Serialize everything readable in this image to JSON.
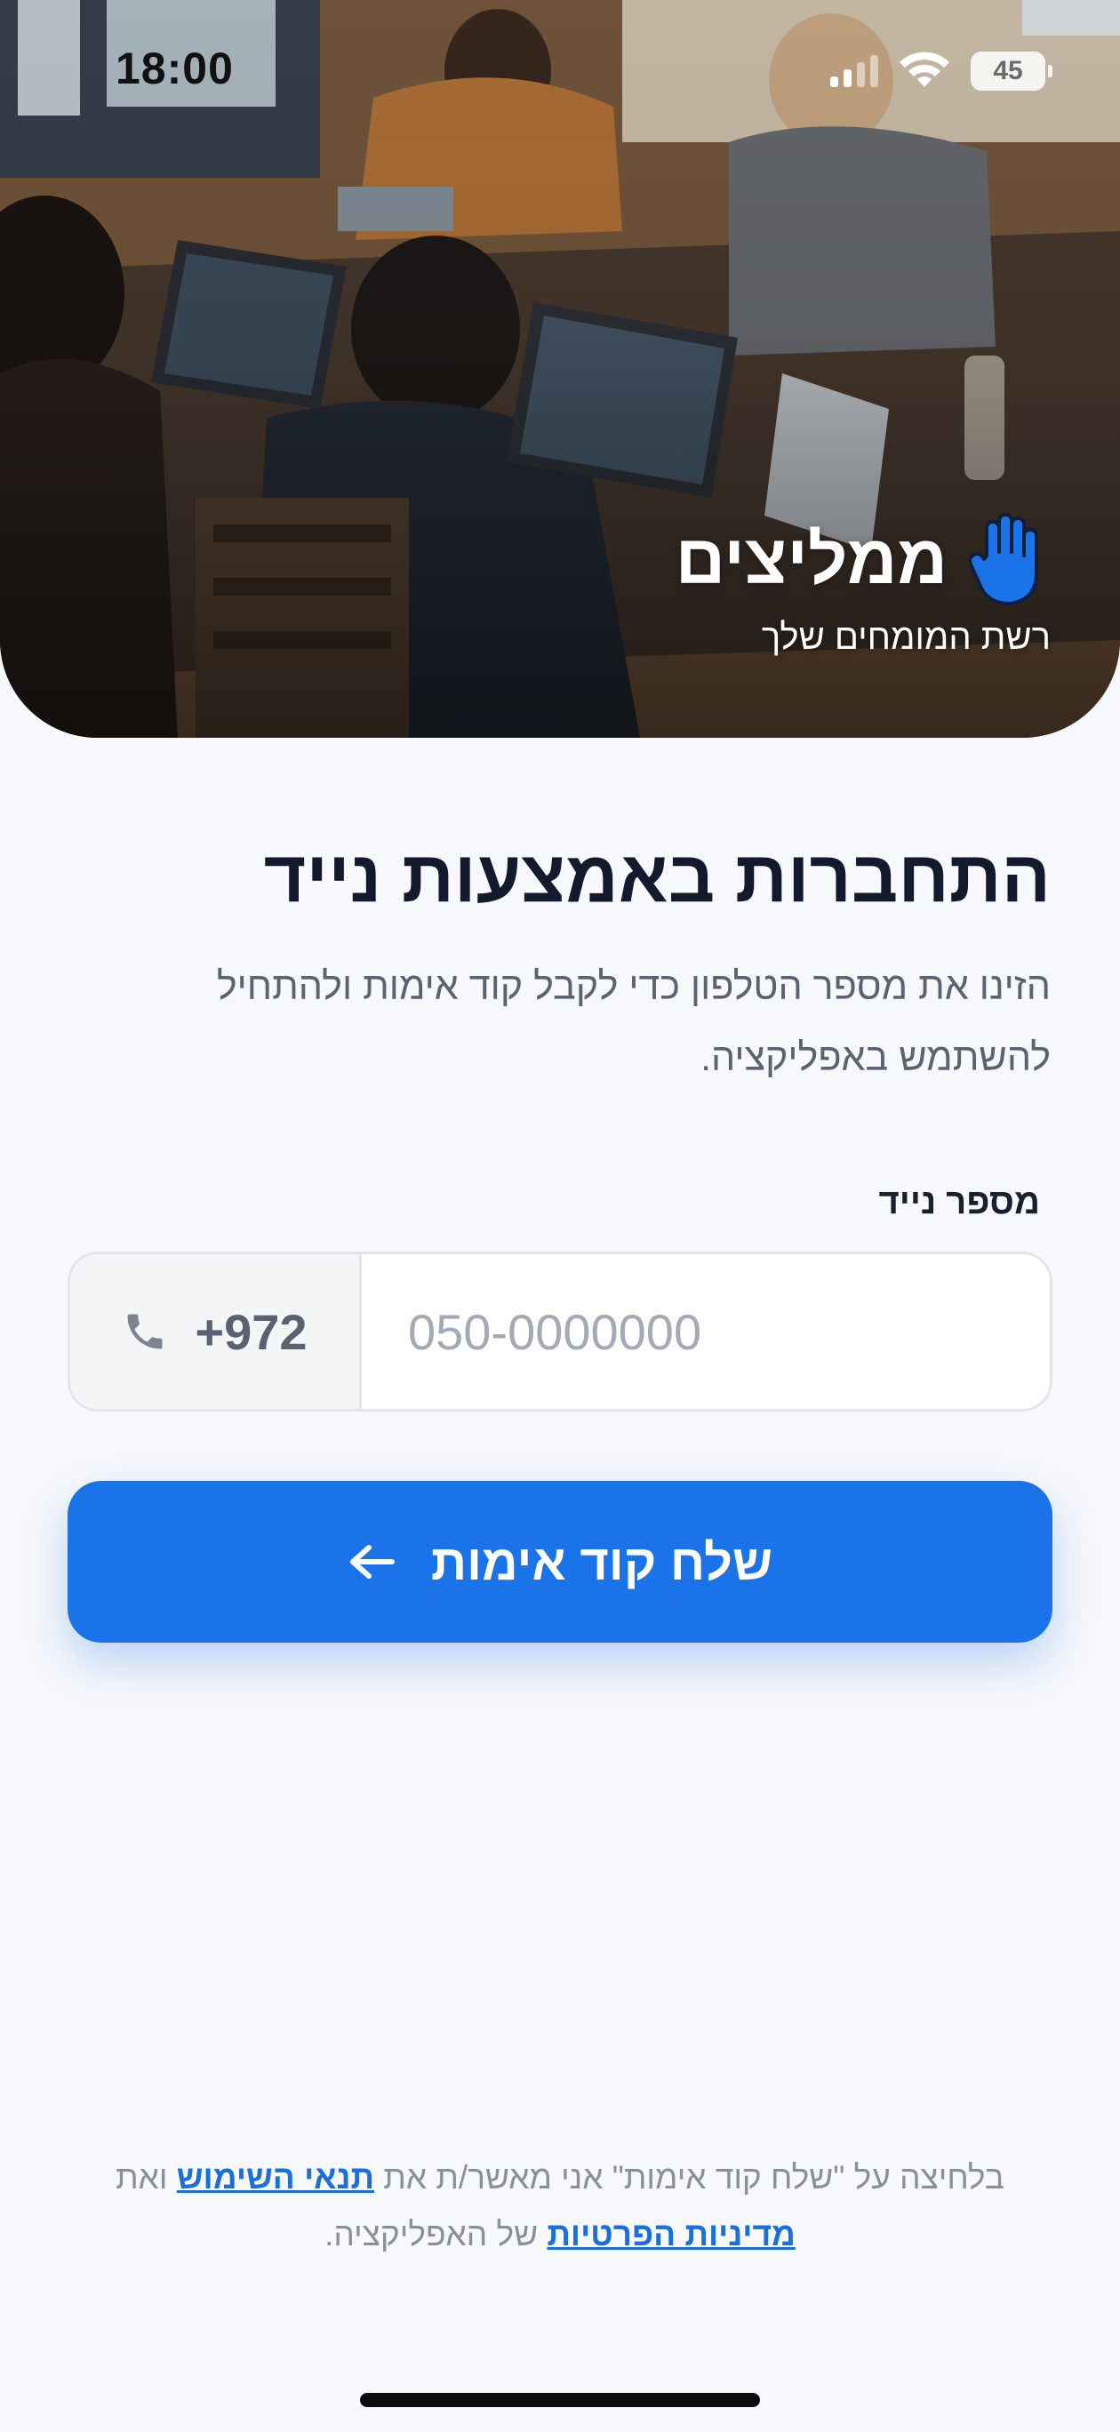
{
  "status_bar": {
    "time": "18:00",
    "battery": "45"
  },
  "hero": {
    "brand_name": "ממליצים",
    "tagline": "רשת המומחים שלך",
    "brand_icon": "hand-icon"
  },
  "login": {
    "title": "התחברות באמצעות נייד",
    "subtitle": "הזינו את מספר הטלפון כדי לקבל קוד אימות ולהתחיל להשתמש באפליקציה.",
    "phone_label": "מספר נייד",
    "country_code": "+972",
    "phone_placeholder": "050-0000000",
    "phone_value": "",
    "send_button": "שלח קוד אימות"
  },
  "legal": {
    "prefix": "בלחיצה על \"שלח קוד אימות\" אני מאשר/ת את ",
    "terms_link": "תנאי השימוש",
    "middle": " ואת ",
    "privacy_link": "מדיניות הפרטיות",
    "suffix": " של האפליקציה."
  },
  "colors": {
    "accent": "#1a73e8",
    "background": "#f7f8fb",
    "title": "#141a2e"
  }
}
